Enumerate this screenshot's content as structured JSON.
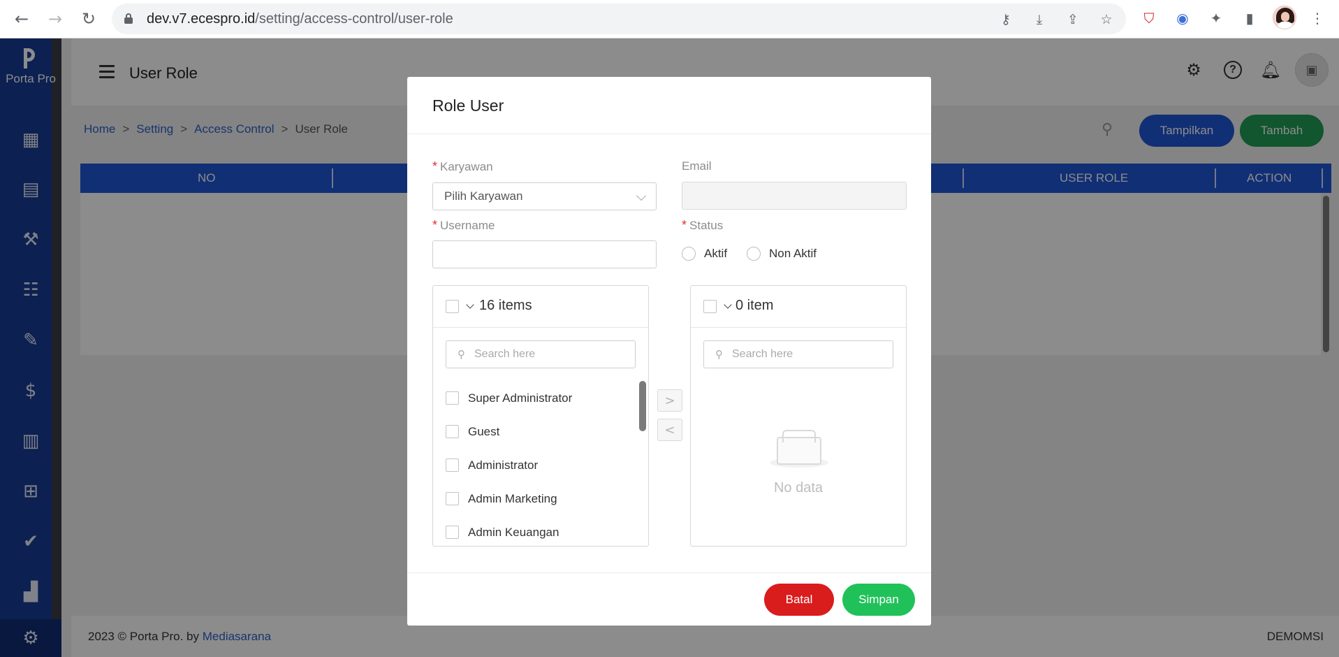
{
  "browser": {
    "url_host": "dev.v7.ecespro.id",
    "url_path": "/setting/access-control/user-role",
    "back_icon": "arrow-left-icon",
    "forward_icon": "arrow-right-icon",
    "reload_icon": "reload-icon"
  },
  "sidebar": {
    "brand": "Porta Pro",
    "icons": [
      "dashboard-icon",
      "monitor-icon",
      "tools-icon",
      "clipboard-icon",
      "megaphone-icon",
      "finance-icon",
      "invoice-icon",
      "gift-icon",
      "check-badge-icon",
      "chart-icon",
      "settings-icon"
    ]
  },
  "header": {
    "title": "User Role"
  },
  "breadcrumb": {
    "items": [
      "Home",
      "Setting",
      "Access Control"
    ],
    "current": "User Role",
    "separator": ">"
  },
  "actions": {
    "show_label": "Tampilkan",
    "add_label": "Tambah",
    "show_color": "#1f57d6",
    "add_color": "#1f9d55"
  },
  "table": {
    "columns": [
      "NO",
      "USER ROLE",
      "ACTION"
    ]
  },
  "footer": {
    "copyright": "2023 © Porta Pro. by",
    "link": "Mediasarana",
    "user": "DEMOMSI"
  },
  "modal": {
    "title": "Role User",
    "employee_label": "Karyawan",
    "employee_placeholder": "Pilih Karyawan",
    "email_label": "Email",
    "email_value": "",
    "username_label": "Username",
    "username_value": "",
    "status_label": "Status",
    "status_options": [
      "Aktif",
      "Non Aktif"
    ],
    "source": {
      "count_label": "16 items",
      "search_placeholder": "Search here",
      "items": [
        "Super Administrator",
        "Guest",
        "Administrator",
        "Admin Marketing",
        "Admin Keuangan"
      ]
    },
    "target": {
      "count_label": "0 item",
      "search_placeholder": "Search here",
      "empty_text": "No data"
    },
    "move_right": ">",
    "move_left": "<",
    "cancel_label": "Batal",
    "save_label": "Simpan",
    "cancel_color": "#d91c1c",
    "save_color": "#21c15a"
  }
}
